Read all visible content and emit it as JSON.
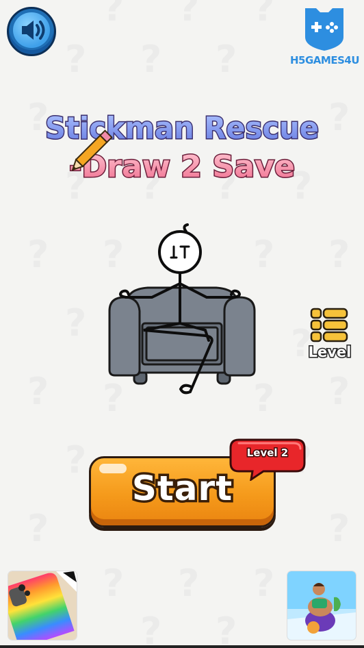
{
  "brand": {
    "name": "H5GAMES4U"
  },
  "title": {
    "line1": "Stickman Rescue",
    "line2": "-Draw 2 Save"
  },
  "level_button": {
    "label": "Level"
  },
  "start_button": {
    "label": "Start"
  },
  "level_badge": {
    "label": "Level 2"
  },
  "icons": {
    "sound": "speaker-icon",
    "brand": "gamepad-shield-icon",
    "level": "list-icon",
    "pencil": "pencil-icon"
  },
  "colors": {
    "background": "#f4f4f2",
    "start_button": "#f59a1b",
    "sound_button": "#3fa0ea",
    "level_badge": "#e8262a",
    "brand": "#2d8ee0",
    "level_icon": "#f6c23a"
  }
}
